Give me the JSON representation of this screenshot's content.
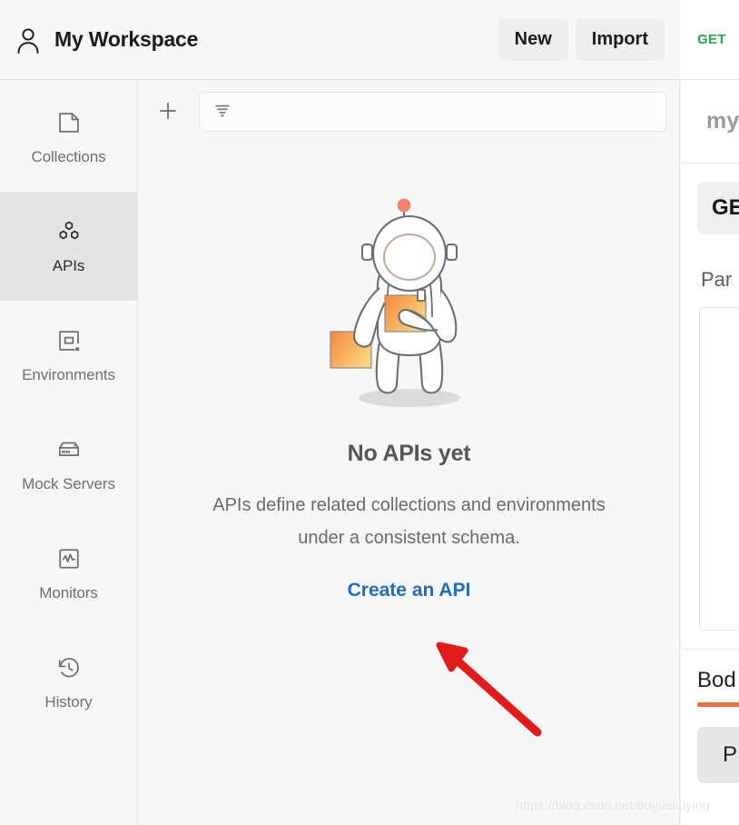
{
  "header": {
    "workspace_icon": "person-icon",
    "workspace_title": "My Workspace",
    "new_label": "New",
    "import_label": "Import"
  },
  "sidebar": {
    "items": [
      {
        "id": "collections",
        "label": "Collections",
        "icon": "folder-icon",
        "active": false
      },
      {
        "id": "apis",
        "label": "APIs",
        "icon": "hexagons-icon",
        "active": true
      },
      {
        "id": "environments",
        "label": "Environments",
        "icon": "environment-icon",
        "active": false
      },
      {
        "id": "mock-servers",
        "label": "Mock Servers",
        "icon": "server-icon",
        "active": false
      },
      {
        "id": "monitors",
        "label": "Monitors",
        "icon": "pulse-icon",
        "active": false
      },
      {
        "id": "history",
        "label": "History",
        "icon": "clock-history-icon",
        "active": false
      }
    ]
  },
  "middle": {
    "add_icon": "plus-icon",
    "filter_icon": "filter-icon",
    "filter_placeholder": "",
    "filter_value": "",
    "empty_state": {
      "illustration": "astronaut-illustration",
      "title": "No APIs yet",
      "description": "APIs define related collections and environments under a consistent schema.",
      "cta_label": "Create an API"
    }
  },
  "right_panel": {
    "tab_method": "GET",
    "request_name": "my",
    "method_button": "GE",
    "params_label": "Par",
    "body_tab": "Bod",
    "send_button": "P"
  },
  "annotation": {
    "arrow": "red-arrow-pointing-to-create-an-api"
  },
  "watermark": {
    "text": "https://blog.csdn.net/buyueliuying"
  },
  "colors": {
    "accent_link": "#1f6dc4",
    "method_get": "#29a745",
    "body_underline": "#f26b3a",
    "active_nav_bg": "#e4e4e4",
    "arrow": "#e51a1a",
    "illustration_orange": "#f59a4b"
  }
}
